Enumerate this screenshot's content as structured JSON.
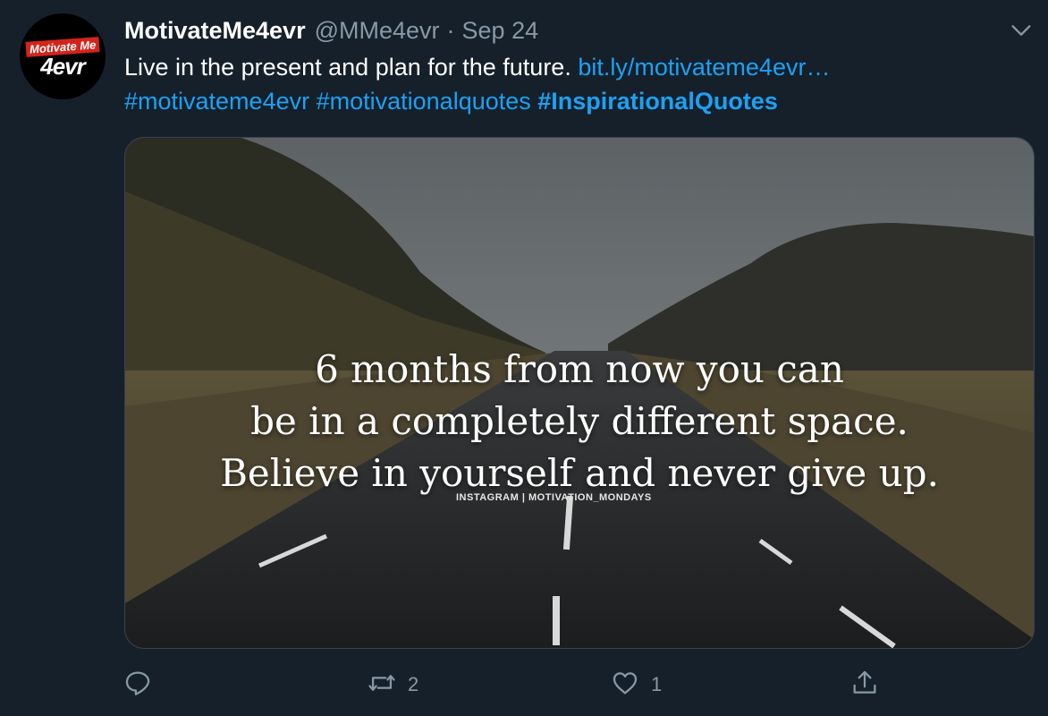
{
  "user": {
    "display_name": "MotivateMe4evr",
    "handle": "@MMe4evr",
    "separator": "·",
    "date": "Sep 24",
    "avatar": {
      "logo_top": "Motivate Me",
      "logo_bottom": "4evr"
    }
  },
  "tweet": {
    "text": "Live in the present and plan for the future.",
    "link": "bit.ly/motivateme4evr…",
    "hashtags": [
      "#motivateme4evr",
      "#motivationalquotes",
      "#InspirationalQuotes"
    ]
  },
  "media": {
    "quote_lines": [
      "6 months from now you can",
      "be in a completely different space.",
      "Believe in yourself and never give up."
    ],
    "credit": "INSTAGRAM | MOTIVATION_MONDAYS"
  },
  "actions": {
    "reply_icon": "reply-icon",
    "retweet_icon": "retweet-icon",
    "retweet_count": "2",
    "like_icon": "heart-icon",
    "like_count": "1",
    "share_icon": "share-icon"
  },
  "colors": {
    "background": "#15202b",
    "link": "#1da1f2",
    "muted": "#8899a6"
  }
}
